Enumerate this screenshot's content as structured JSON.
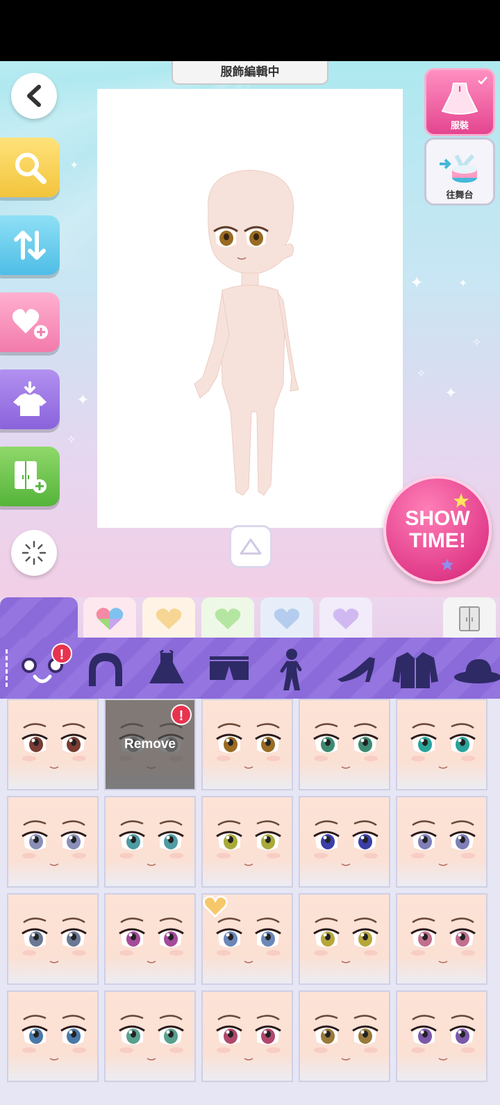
{
  "header": {
    "title": "服飾編輯中"
  },
  "right_tabs": [
    {
      "label": "服裝",
      "selected": true
    },
    {
      "label": "往舞台",
      "selected": false
    }
  ],
  "showtime": {
    "label": "SHOW TIME!"
  },
  "left_buttons": [
    {
      "icon": "chevron-left-icon"
    },
    {
      "icon": "search-icon"
    },
    {
      "icon": "sort-icon"
    },
    {
      "icon": "heart-add-icon"
    },
    {
      "icon": "shirt-download-icon"
    },
    {
      "icon": "wardrobe-add-icon"
    },
    {
      "icon": "loading-icon"
    }
  ],
  "category_tabs": [
    {
      "icon": "all-items-icon"
    },
    {
      "icon": "multicolor-heart-icon"
    },
    {
      "icon": "yellow-heart-icon"
    },
    {
      "icon": "green-heart-icon"
    },
    {
      "icon": "blue-heart-icon"
    },
    {
      "icon": "purple-heart-icon"
    },
    {
      "icon": "wardrobe-icon"
    }
  ],
  "part_icons": [
    "face-icon",
    "hair-icon",
    "dress-icon",
    "shorts-icon",
    "pose-icon",
    "heel-shoe-icon",
    "jacket-icon",
    "hat-icon"
  ],
  "remove_label": "Remove",
  "alert_mark": "!",
  "colors": {
    "accent_pink": "#e23d8b",
    "purple_bar": "#8b6ad9",
    "alert_red": "#e8334f"
  },
  "face_grid": [
    {
      "eye": "#7a3b32"
    },
    {
      "remove": true
    },
    {
      "eye": "#9a6b22"
    },
    {
      "eye": "#3d8a72"
    },
    {
      "eye": "#2aa39a"
    },
    {
      "eye": "#8a8fb8"
    },
    {
      "eye": "#4f9ba3"
    },
    {
      "eye": "#a9a93a"
    },
    {
      "eye": "#3b3ea8"
    },
    {
      "eye": "#7f7fb8"
    },
    {
      "eye": "#6a7894"
    },
    {
      "eye": "#a44a9a"
    },
    {
      "eye": "#6a87b8",
      "heart": true
    },
    {
      "eye": "#b7a63a"
    },
    {
      "eye": "#c2708e"
    },
    {
      "eye": "#4a78a8"
    },
    {
      "eye": "#5aa08e"
    },
    {
      "eye": "#b0486a"
    },
    {
      "eye": "#9a7a3a"
    },
    {
      "eye": "#7c58a8"
    }
  ]
}
